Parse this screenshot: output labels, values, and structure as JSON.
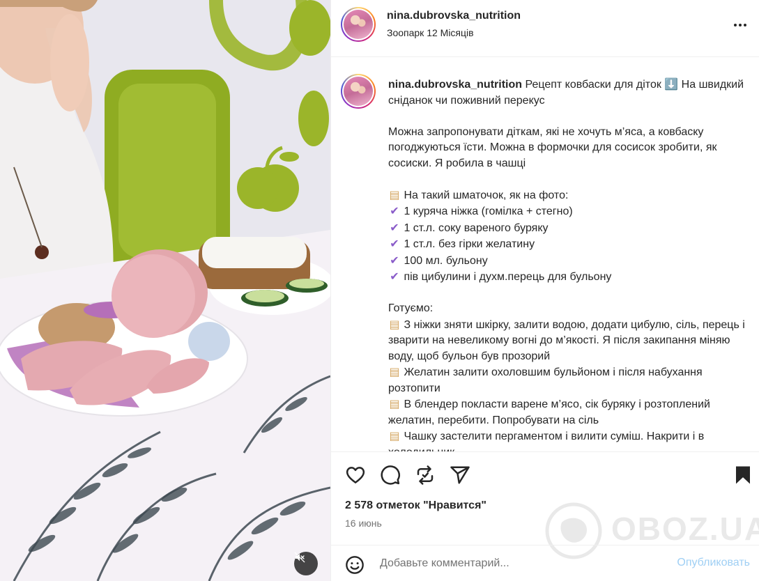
{
  "post": {
    "username": "nina.dubrovska_nutrition",
    "audio": "Зоопарк 12 Місяців",
    "caption": {
      "username": "nina.dubrovska_nutrition",
      "intro": "Рецепт ковбаски для діток ⬇️  На швидкий сніданок чи поживний перекус",
      "para2": "Можна запропонувати діткам, які не хочуть м’яса, а ковбаску погоджуються їсти. Можна в формочки для сосисок зробити, як сосиски. Я робила в чашці",
      "portion_header": "На такий шматочок, як на фото:",
      "ingredients": [
        "1 куряча ніжка (гомілка + стегно)",
        "1 ст.л. соку вареного буряку",
        "1 ст.л. без гірки желатину",
        "100 мл. бульону",
        "пів цибулини і духм.перець для бульону"
      ],
      "steps_header": "Готуємо:",
      "steps": [
        "З ніжки зняти шкірку, залити водою, додати цибулю, сіль, перець і зварити на невеликому вогні до м’якості. Я після закипання міняю воду, щоб бульон був прозорий",
        "Желатин залити охоловшим бульйоном і після набухання розтопити",
        "В блендер покласти варене м’ясо, сік буряку і розтоплений желатин, перебити. Попробувати на сіль",
        "Чашку застелити пергаментом і вилити суміш. Накрити і в холодильник."
      ]
    },
    "likes": "2 578 отметок \"Нравится\"",
    "date": "16 июнь"
  },
  "comment": {
    "placeholder": "Добавьте комментарий...",
    "publish_label": "Опубликовать"
  },
  "watermark": "OBOZ.UA",
  "icons": {
    "more": "more-options-icon",
    "like": "heart-icon",
    "comment": "comment-icon",
    "repost": "repost-icon",
    "share": "share-icon",
    "save": "bookmark-icon",
    "emoji": "emoji-icon",
    "mute": "muted-speaker-icon"
  },
  "colors": {
    "accent_check": "#8a5cc9",
    "publish_disabled": "#9fcff4",
    "muted_text": "#737373"
  }
}
